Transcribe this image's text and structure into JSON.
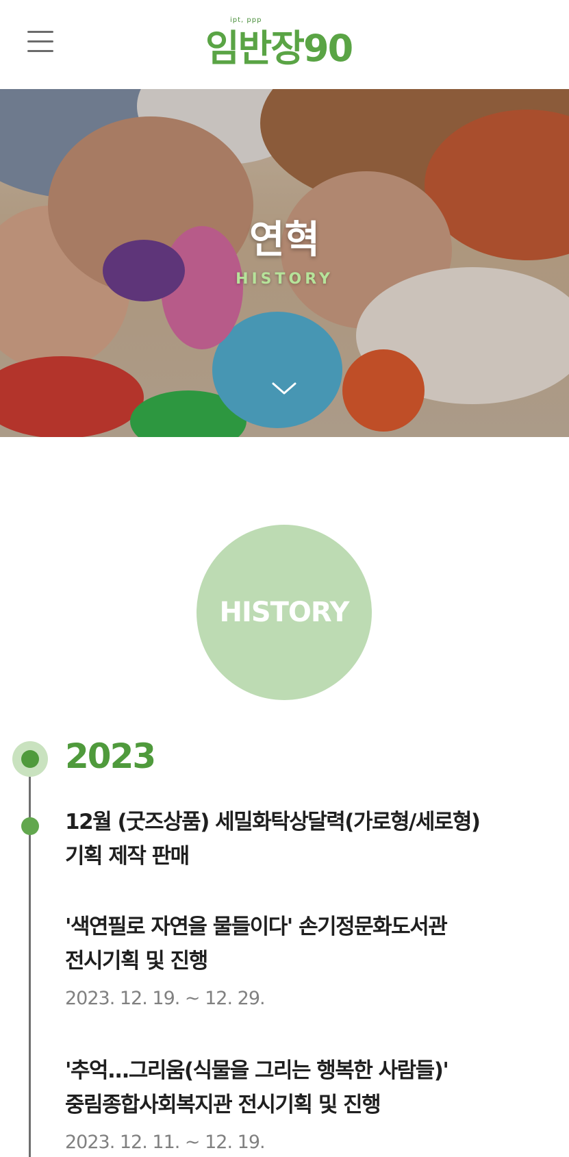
{
  "header": {
    "menu_icon": "hamburger-menu-icon",
    "logo_small_text": "ipt, ppp",
    "logo_text": "임반장90"
  },
  "hero": {
    "title": "연혁",
    "subtitle": "HISTORY",
    "scroll_icon": "chevron-down-icon"
  },
  "section": {
    "badge": "HISTORY"
  },
  "timeline": {
    "year": "2023",
    "entries": [
      {
        "line1": "12월 (굿즈상품) 세밀화탁상달력(가로형/세로형)",
        "line2": "기획 제작 판매"
      },
      {
        "line1": "'색연필로 자연을 물들이다' 손기정문화도서관",
        "line2": "전시기획 및 진행",
        "date": "2023. 12. 19. ~ 12. 29."
      },
      {
        "line1": "'추억...그리움(식물을 그리는 행복한 사람들)'",
        "line2": "중림종합사회복지관 전시기획 및 진행",
        "date": "2023. 12. 11. ~ 12. 19."
      }
    ]
  },
  "colors": {
    "brand_green": "#5aa445",
    "year_green": "#4f9a3c",
    "circle_green": "#bddbb3",
    "hero_subtitle": "#b6e39a"
  }
}
